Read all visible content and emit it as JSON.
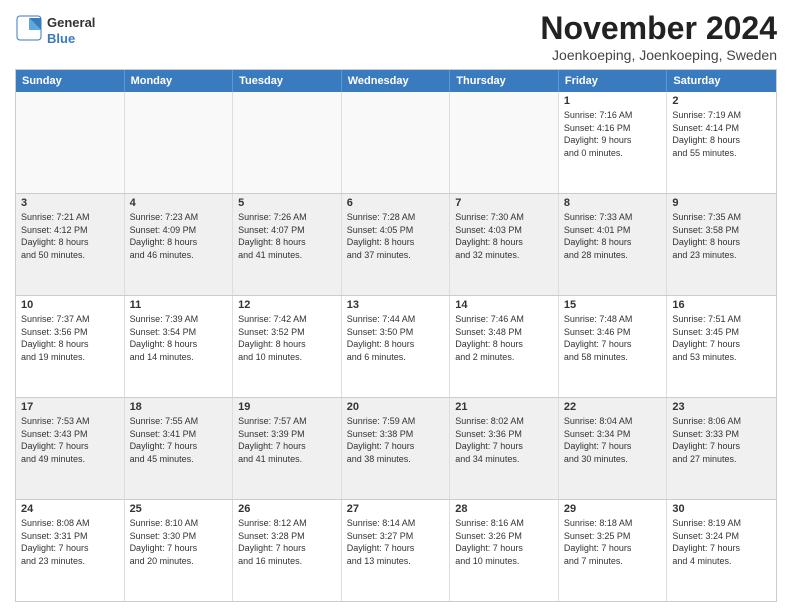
{
  "header": {
    "logo_general": "General",
    "logo_blue": "Blue",
    "title": "November 2024",
    "subtitle": "Joenkoeping, Joenkoeping, Sweden"
  },
  "weekdays": [
    "Sunday",
    "Monday",
    "Tuesday",
    "Wednesday",
    "Thursday",
    "Friday",
    "Saturday"
  ],
  "weeks": [
    [
      {
        "day": "",
        "info": ""
      },
      {
        "day": "",
        "info": ""
      },
      {
        "day": "",
        "info": ""
      },
      {
        "day": "",
        "info": ""
      },
      {
        "day": "",
        "info": ""
      },
      {
        "day": "1",
        "info": "Sunrise: 7:16 AM\nSunset: 4:16 PM\nDaylight: 9 hours\nand 0 minutes."
      },
      {
        "day": "2",
        "info": "Sunrise: 7:19 AM\nSunset: 4:14 PM\nDaylight: 8 hours\nand 55 minutes."
      }
    ],
    [
      {
        "day": "3",
        "info": "Sunrise: 7:21 AM\nSunset: 4:12 PM\nDaylight: 8 hours\nand 50 minutes."
      },
      {
        "day": "4",
        "info": "Sunrise: 7:23 AM\nSunset: 4:09 PM\nDaylight: 8 hours\nand 46 minutes."
      },
      {
        "day": "5",
        "info": "Sunrise: 7:26 AM\nSunset: 4:07 PM\nDaylight: 8 hours\nand 41 minutes."
      },
      {
        "day": "6",
        "info": "Sunrise: 7:28 AM\nSunset: 4:05 PM\nDaylight: 8 hours\nand 37 minutes."
      },
      {
        "day": "7",
        "info": "Sunrise: 7:30 AM\nSunset: 4:03 PM\nDaylight: 8 hours\nand 32 minutes."
      },
      {
        "day": "8",
        "info": "Sunrise: 7:33 AM\nSunset: 4:01 PM\nDaylight: 8 hours\nand 28 minutes."
      },
      {
        "day": "9",
        "info": "Sunrise: 7:35 AM\nSunset: 3:58 PM\nDaylight: 8 hours\nand 23 minutes."
      }
    ],
    [
      {
        "day": "10",
        "info": "Sunrise: 7:37 AM\nSunset: 3:56 PM\nDaylight: 8 hours\nand 19 minutes."
      },
      {
        "day": "11",
        "info": "Sunrise: 7:39 AM\nSunset: 3:54 PM\nDaylight: 8 hours\nand 14 minutes."
      },
      {
        "day": "12",
        "info": "Sunrise: 7:42 AM\nSunset: 3:52 PM\nDaylight: 8 hours\nand 10 minutes."
      },
      {
        "day": "13",
        "info": "Sunrise: 7:44 AM\nSunset: 3:50 PM\nDaylight: 8 hours\nand 6 minutes."
      },
      {
        "day": "14",
        "info": "Sunrise: 7:46 AM\nSunset: 3:48 PM\nDaylight: 8 hours\nand 2 minutes."
      },
      {
        "day": "15",
        "info": "Sunrise: 7:48 AM\nSunset: 3:46 PM\nDaylight: 7 hours\nand 58 minutes."
      },
      {
        "day": "16",
        "info": "Sunrise: 7:51 AM\nSunset: 3:45 PM\nDaylight: 7 hours\nand 53 minutes."
      }
    ],
    [
      {
        "day": "17",
        "info": "Sunrise: 7:53 AM\nSunset: 3:43 PM\nDaylight: 7 hours\nand 49 minutes."
      },
      {
        "day": "18",
        "info": "Sunrise: 7:55 AM\nSunset: 3:41 PM\nDaylight: 7 hours\nand 45 minutes."
      },
      {
        "day": "19",
        "info": "Sunrise: 7:57 AM\nSunset: 3:39 PM\nDaylight: 7 hours\nand 41 minutes."
      },
      {
        "day": "20",
        "info": "Sunrise: 7:59 AM\nSunset: 3:38 PM\nDaylight: 7 hours\nand 38 minutes."
      },
      {
        "day": "21",
        "info": "Sunrise: 8:02 AM\nSunset: 3:36 PM\nDaylight: 7 hours\nand 34 minutes."
      },
      {
        "day": "22",
        "info": "Sunrise: 8:04 AM\nSunset: 3:34 PM\nDaylight: 7 hours\nand 30 minutes."
      },
      {
        "day": "23",
        "info": "Sunrise: 8:06 AM\nSunset: 3:33 PM\nDaylight: 7 hours\nand 27 minutes."
      }
    ],
    [
      {
        "day": "24",
        "info": "Sunrise: 8:08 AM\nSunset: 3:31 PM\nDaylight: 7 hours\nand 23 minutes."
      },
      {
        "day": "25",
        "info": "Sunrise: 8:10 AM\nSunset: 3:30 PM\nDaylight: 7 hours\nand 20 minutes."
      },
      {
        "day": "26",
        "info": "Sunrise: 8:12 AM\nSunset: 3:28 PM\nDaylight: 7 hours\nand 16 minutes."
      },
      {
        "day": "27",
        "info": "Sunrise: 8:14 AM\nSunset: 3:27 PM\nDaylight: 7 hours\nand 13 minutes."
      },
      {
        "day": "28",
        "info": "Sunrise: 8:16 AM\nSunset: 3:26 PM\nDaylight: 7 hours\nand 10 minutes."
      },
      {
        "day": "29",
        "info": "Sunrise: 8:18 AM\nSunset: 3:25 PM\nDaylight: 7 hours\nand 7 minutes."
      },
      {
        "day": "30",
        "info": "Sunrise: 8:19 AM\nSunset: 3:24 PM\nDaylight: 7 hours\nand 4 minutes."
      }
    ]
  ]
}
